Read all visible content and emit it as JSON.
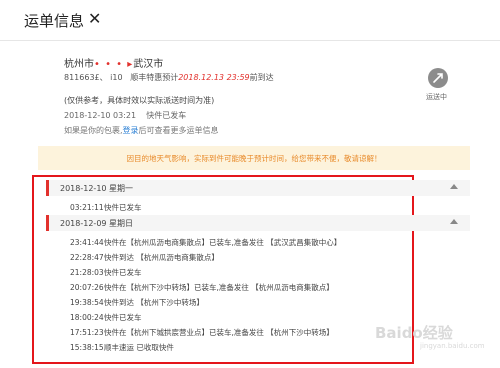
{
  "header": {
    "title": "运单信息",
    "close": "✕"
  },
  "summary": {
    "from": "杭州市",
    "dots": "• • • ▸",
    "to": "武汉市",
    "number": "811663£、 i10",
    "estimate_prefix": "顺丰特惠预计",
    "estimate_time": "2018.12.13 23:59",
    "estimate_suffix": "前到达",
    "note": "(仅供参考，具体时效以实际派送时间为准)",
    "sent_time": "2018-12-10 03:21",
    "sent_status": "快件已发车",
    "login_prefix": "如果是你的包裹,",
    "login_link": "登录",
    "login_suffix": "后可查看更多运单信息",
    "status_label": "运送中",
    "status_icon": "truck-icon"
  },
  "notice": "因目的地天气影响，实际到件可能晚于预计时间，给您带来不便，敬请谅解！",
  "groups": [
    {
      "date": "2018-12-10 星期一",
      "events": [
        {
          "time": "03:21:11",
          "text": "快件已发车"
        }
      ]
    },
    {
      "date": "2018-12-09 星期日",
      "events": [
        {
          "time": "23:41:44",
          "text": "快件在【杭州瓜沥电商集散点】已装车,准备发往 【武汉武昌集散中心】"
        },
        {
          "time": "22:28:47",
          "text": "快件到达 【杭州瓜沥电商集散点】"
        },
        {
          "time": "21:28:03",
          "text": "快件已发车"
        },
        {
          "time": "20:07:26",
          "text": "快件在【杭州下沙中转场】已装车,准备发往 【杭州瓜沥电商集散点】"
        },
        {
          "time": "19:38:54",
          "text": "快件到达 【杭州下沙中转场】"
        },
        {
          "time": "18:00:24",
          "text": "快件已发车"
        },
        {
          "time": "17:51:23",
          "text": "快件在【杭州下城拱宸营业点】已装车,准备发往 【杭州下沙中转场】"
        },
        {
          "time": "15:38:15",
          "text": "顺丰速运 已收取快件"
        }
      ]
    }
  ],
  "watermark": {
    "main": "Baido经验",
    "sub": "jingyan.baidu.com"
  },
  "colors": {
    "accent": "#e2312d",
    "box": "#e4161b",
    "notice_bg": "#fdf3dc",
    "notice_text": "#e88a2a",
    "link": "#2a7fd4"
  }
}
